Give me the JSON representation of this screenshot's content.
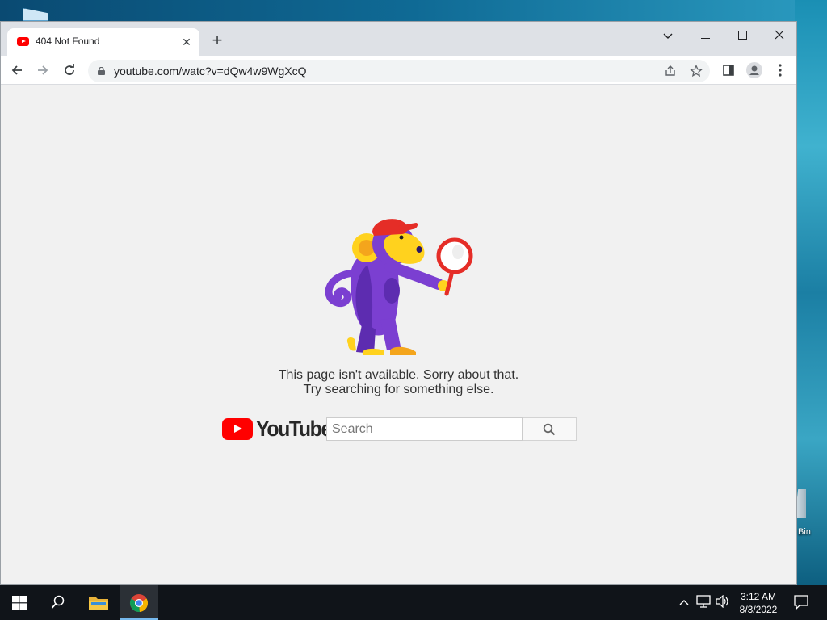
{
  "browser": {
    "tab": {
      "title": "404 Not Found",
      "close_label": "✕"
    },
    "new_tab_label": "+",
    "window_controls": {
      "dropdown": "⌄",
      "minimize": "—",
      "maximize": "☐",
      "close": "✕"
    },
    "url": "youtube.com/watc?v=dQw4w9WgXcQ"
  },
  "page": {
    "message_line1": "This page isn't available. Sorry about that.",
    "message_line2": "Try searching for something else.",
    "logo_text": "YouTube",
    "search_placeholder": "Search",
    "search_value": ""
  },
  "desktop": {
    "recycle_bin_label": "Bin"
  },
  "taskbar": {
    "time": "3:12 AM",
    "date": "8/3/2022",
    "apps": [
      "start-button",
      "search",
      "file-explorer",
      "chrome"
    ]
  },
  "colors": {
    "youtube_red": "#ff0000",
    "monkey_purple": "#7b3fd1",
    "monkey_yellow": "#ffd21e",
    "cap_red": "#e52d27"
  }
}
